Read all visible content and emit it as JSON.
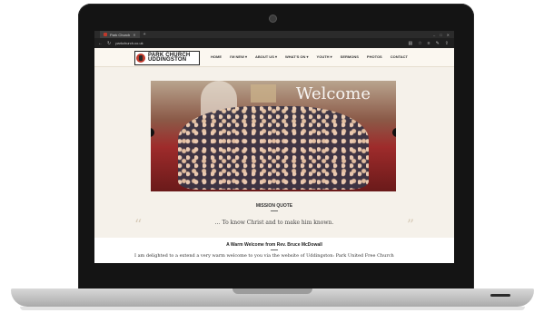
{
  "browser": {
    "tab_title": "Park Church",
    "url": "parkchurch.co.uk"
  },
  "site": {
    "logo_line1": "PARK CHURCH",
    "logo_line2": "UDDINGSTON",
    "menu": [
      "HOME",
      "I'M NEW ▾",
      "ABOUT US ▾",
      "WHAT'S ON ▾",
      "YOUTH ▾",
      "SERMONS",
      "PHOTOS",
      "CONTACT"
    ]
  },
  "hero": {
    "title": "Welcome"
  },
  "mission": {
    "title": "MISSION QUOTE",
    "quote": "… To know Christ and to make him known."
  },
  "welcome": {
    "title": "A Warm Welcome from Rev. Bruce McDowall",
    "body": "I am delighted to a extend a very warm welcome to you via the website of Uddingston: Park United Free Church"
  },
  "colors": {
    "accent": "#c0392b",
    "page_bg": "#f5f1ea"
  }
}
